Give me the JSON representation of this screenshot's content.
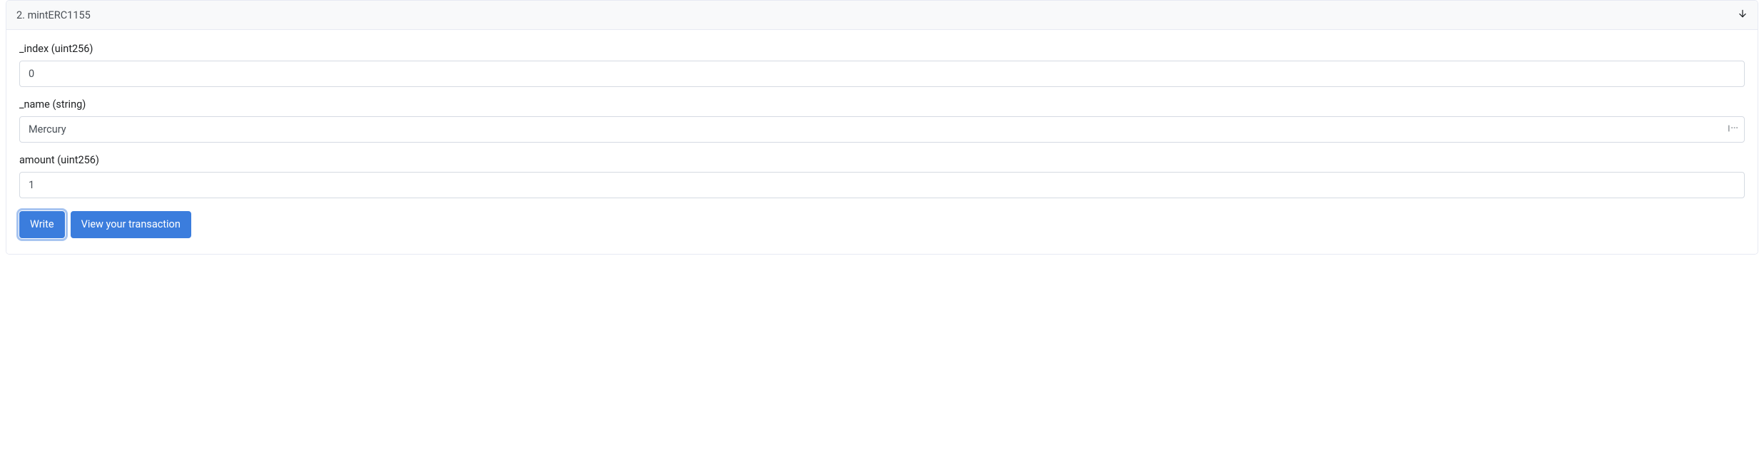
{
  "function": {
    "index": "2",
    "name": "mintERC1155",
    "header_text": "2. mintERC1155"
  },
  "fields": [
    {
      "label": "_index (uint256)",
      "value": "0",
      "placeholder": "",
      "has_icon": false,
      "name": "input-index"
    },
    {
      "label": "_name (string)",
      "value": "Mercury",
      "placeholder": "",
      "has_icon": true,
      "name": "input-name"
    },
    {
      "label": "amount (uint256)",
      "value": "1",
      "placeholder": "",
      "has_icon": false,
      "name": "input-amount"
    }
  ],
  "buttons": {
    "write": "Write",
    "view_tx": "View your transaction"
  }
}
